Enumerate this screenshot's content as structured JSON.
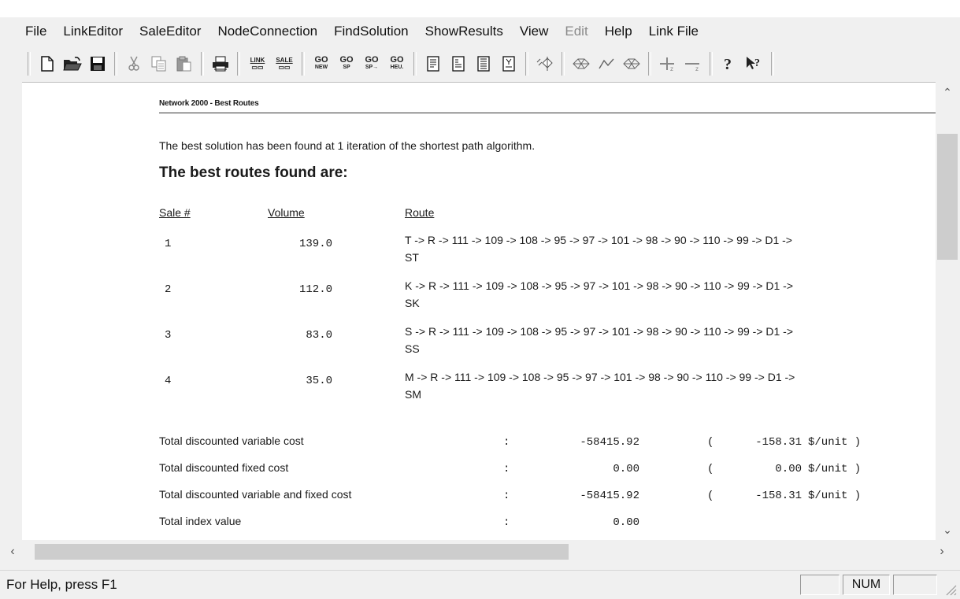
{
  "menu": [
    "File",
    "LinkEditor",
    "SaleEditor",
    "NodeConnection",
    "FindSolution",
    "ShowResults",
    "View",
    "Edit",
    "Help",
    "Link File"
  ],
  "menu_disabled": [
    "Edit"
  ],
  "toolbar": {
    "link_top": "LINK",
    "sale_top": "SALE",
    "go1": {
      "top": "GO",
      "bottom": "NEW"
    },
    "go2": {
      "top": "GO",
      "bottom": "SP"
    },
    "go3": {
      "top": "GO",
      "bottom": "SP→"
    },
    "go4": {
      "top": "GO",
      "bottom": "HEU."
    }
  },
  "report": {
    "header": "Network 2000 - Best Routes",
    "intro": "The best solution has been found at 1 iteration of the shortest path algorithm.",
    "heading": "The best routes found are:",
    "columns": {
      "sale": "Sale #",
      "volume": "Volume",
      "route": "Route"
    },
    "rows": [
      {
        "sale": "1",
        "volume": "139.0",
        "route": "T -> R -> 111 -> 109 -> 108 -> 95 -> 97 -> 101 -> 98 -> 90 -> 110 -> 99 -> D1 ->",
        "route_cont": "ST"
      },
      {
        "sale": "2",
        "volume": "112.0",
        "route": "K -> R -> 111 -> 109 -> 108 -> 95 -> 97 -> 101 -> 98 -> 90 -> 110 -> 99 -> D1 ->",
        "route_cont": "SK"
      },
      {
        "sale": "3",
        "volume": "83.0",
        "route": "S -> R -> 111 -> 109 -> 108 -> 95 -> 97 -> 101 -> 98 -> 90 -> 110 -> 99 -> D1 ->",
        "route_cont": "SS"
      },
      {
        "sale": "4",
        "volume": "35.0",
        "route": "M -> R -> 111 -> 109 -> 108 -> 95 -> 97 -> 101 -> 98 -> 90 -> 110 -> 99 -> D1 ->",
        "route_cont": "SM"
      }
    ],
    "costs": [
      {
        "label": "Total discounted variable cost",
        "colon": ":",
        "value": "-58415.92",
        "open": "(",
        "per_unit": "-158.31",
        "unit": "$/unit )"
      },
      {
        "label": "Total discounted fixed cost",
        "colon": ":",
        "value": "0.00",
        "open": "(",
        "per_unit": "0.00",
        "unit": "$/unit )"
      },
      {
        "label": "Total discounted variable and fixed cost",
        "colon": ":",
        "value": "-58415.92",
        "open": "(",
        "per_unit": "-158.31",
        "unit": "$/unit )"
      },
      {
        "label": "Total index value",
        "colon": ":",
        "value": "0.00"
      }
    ]
  },
  "status": {
    "help_text": "For Help, press F1",
    "num": "NUM"
  }
}
